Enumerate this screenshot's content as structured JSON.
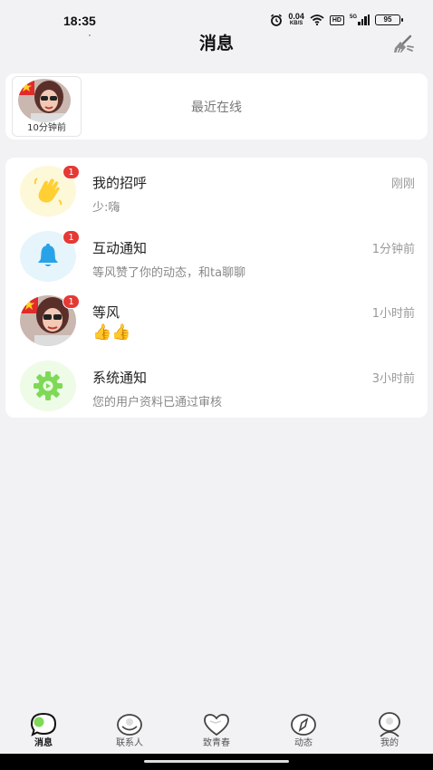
{
  "status_bar": {
    "time": "18:35",
    "net_speed_value": "0.04",
    "net_speed_unit": "KB/S",
    "hd_label": "HD",
    "signal_label": "5G",
    "battery": "95"
  },
  "header": {
    "title": "消息"
  },
  "recent_online": {
    "label": "最近在线",
    "users": [
      {
        "time": "10分钟前"
      }
    ]
  },
  "messages": [
    {
      "title": "我的招呼",
      "preview": "少:嗨",
      "time": "刚刚",
      "badge": "1",
      "icon": "wave-hand-icon"
    },
    {
      "title": "互动通知",
      "preview": "等风赞了你的动态，和ta聊聊",
      "time": "1分钟前",
      "badge": "1",
      "icon": "bell-icon"
    },
    {
      "title": "等风",
      "preview": "👍👍",
      "time": "1小时前",
      "badge": "1",
      "icon": "avatar"
    },
    {
      "title": "系统通知",
      "preview": "您的用户资料已通过审核",
      "time": "3小时前",
      "badge": "",
      "icon": "gear-icon"
    }
  ],
  "bottom_nav": [
    {
      "label": "消息",
      "icon": "message-bubble-icon",
      "active": true
    },
    {
      "label": "联系人",
      "icon": "contacts-icon",
      "active": false
    },
    {
      "label": "致青春",
      "icon": "heart-icon",
      "active": false
    },
    {
      "label": "动态",
      "icon": "compass-icon",
      "active": false
    },
    {
      "label": "我的",
      "icon": "profile-icon",
      "active": false
    }
  ],
  "colors": {
    "badge": "#e53935",
    "accent_green": "#7ed957",
    "bell_blue": "#29a3e8"
  }
}
